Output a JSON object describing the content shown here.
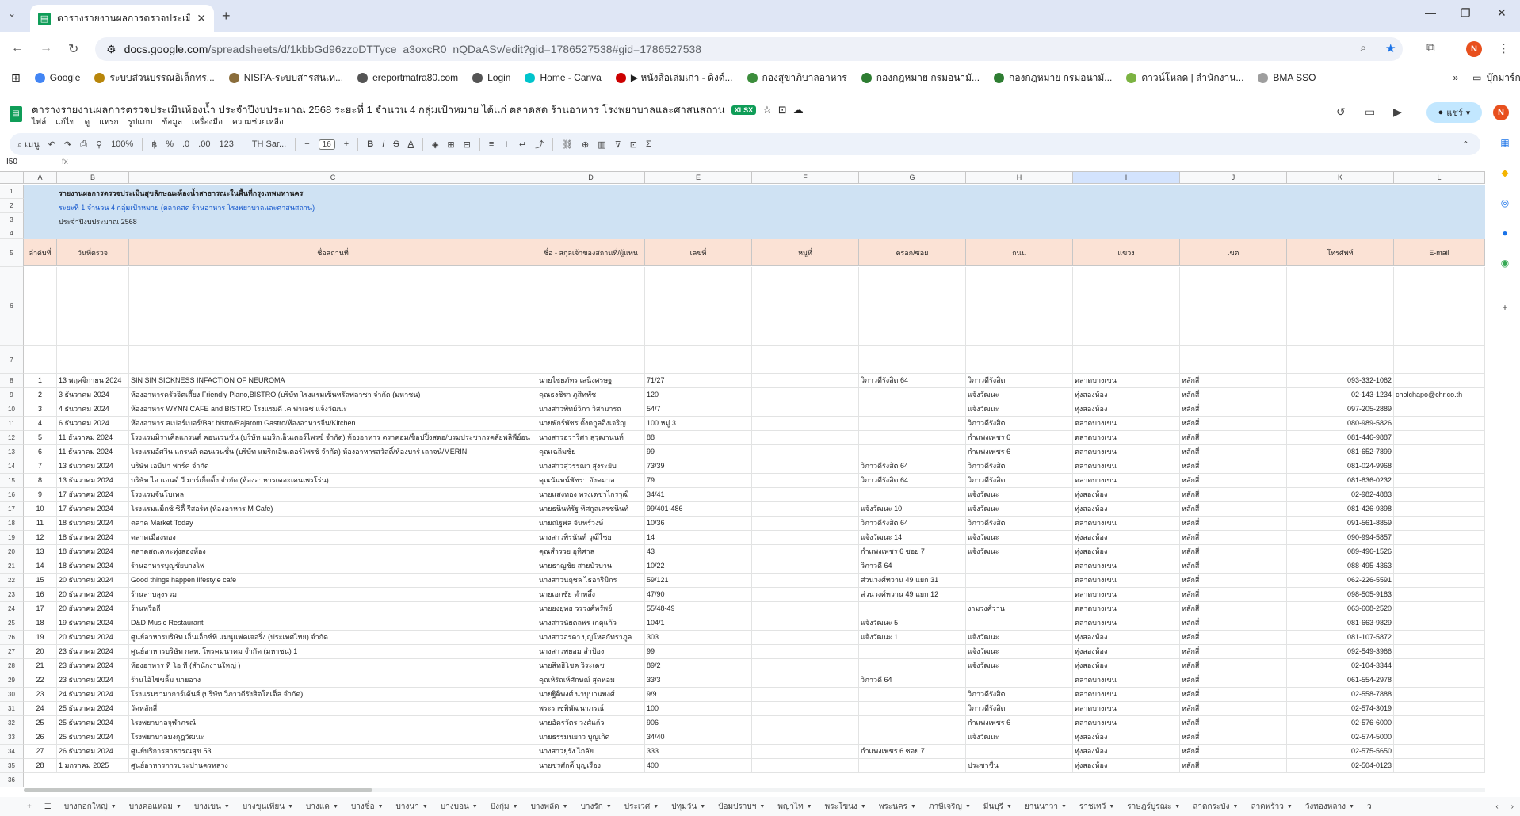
{
  "browser": {
    "tab_title": "ตารางรายงานผลการตรวจประเมินห้อง",
    "url_host": "docs.google.com",
    "url_path": "/spreadsheets/d/1kbbGd96zzoDTTyce_a3oxcR0_nQDaASv/edit?gid=1786527538#gid=1786527538",
    "profile_initial": "N",
    "bookmarks": [
      "Google",
      "ระบบส่วนบรรณอิเล็กทร...",
      "NISPA-ระบบสารสนเท...",
      "ereportmatra80.com",
      "Login",
      "Home - Canva",
      "▶ หนังสือเล่มเก่า - ดิงด์...",
      "กองสุขาภิบาลอาหาร",
      "กองกฎหมาย กรมอนามั...",
      "กองกฎหมาย กรมอนามั...",
      "ดาวน์โหลด | สำนักงาน...",
      "BMA SSO"
    ],
    "bookmarks_folder": "บุ๊กมาร์กทั้งหมด"
  },
  "sheets": {
    "doc_title": "ตารางรายงานผลการตรวจประเมินห้องน้ำ ประจำปีงบประมาณ 2568 ระยะที่ 1 จำนวน 4 กลุ่มเป้าหมาย ได้แก่ ตลาดสด ร้านอาหาร โรงพยาบาลและศาสนสถาน",
    "file_badge": "XLSX",
    "menus": [
      "ไฟล์",
      "แก้ไข",
      "ดู",
      "แทรก",
      "รูปแบบ",
      "ข้อมูล",
      "เครื่องมือ",
      "ความช่วยเหลือ"
    ],
    "share_label": "แชร์",
    "toolbar": {
      "menu": "เมนู",
      "zoom": "100%",
      "currency": "฿",
      "percent": "%",
      "format_123": "123",
      "font": "TH Sar...",
      "font_size": "16"
    },
    "name_box": "I50",
    "fx": "fx"
  },
  "grid": {
    "columns": [
      "A",
      "B",
      "C",
      "D",
      "E",
      "F",
      "G",
      "H",
      "I",
      "J",
      "K",
      "L"
    ],
    "selected_column": "I",
    "row_numbers": [
      "1",
      "2",
      "3",
      "4",
      "5",
      "6",
      "7",
      "8",
      "9",
      "10",
      "11",
      "12",
      "13",
      "14",
      "15",
      "16",
      "17",
      "18",
      "19",
      "20",
      "21",
      "22",
      "23",
      "24",
      "25",
      "26",
      "27",
      "28",
      "29",
      "30",
      "31",
      "32",
      "33",
      "34",
      "35",
      "36"
    ],
    "title_line1": "รายงานผลการตรวจประเมินสุขลักษณะห้องน้ำสาธารณะในพื้นที่กรุงเทพมหานคร",
    "title_line2": "ระยะที่ 1 จำนวน 4 กลุ่มเป้าหมาย (ตลาดสด ร้านอาหาร โรงพยาบาลและศาสนสถาน)",
    "title_line3": "ประจำปีงบประมาณ 2568",
    "headers": [
      "ลำดับที่",
      "วันที่ตรวจ",
      "ชื่อสถานที่",
      "ชื่อ - สกุลเจ้าของสถานที่/ผู้แทน",
      "เลขที่",
      "หมู่ที่",
      "ตรอก/ซอย",
      "ถนน",
      "แขวง",
      "เขต",
      "โทรศัพท์",
      "E-mail"
    ],
    "rows": [
      [
        "1",
        "13 พฤศจิกายน 2024",
        "SIN SIN SICKNESS INFACTION OF NEUROMA",
        "นายไชยภัทร เลนิ่งศรษฐ",
        "71/27",
        "",
        "วิภาวดีรังสิต 64",
        "วิภาวดีรังสิต",
        "ตลาดบางเขน",
        "หลักสี่",
        "093-332-1062",
        ""
      ],
      [
        "2",
        "3 ธันวาคม 2024",
        "ห้องอาหารครัวจิตเสี้ยง,Friendly Piano,BISTRO (บริษัท โรงแรมเซ็นทรัลพลาซา จำกัด (มหาชน)",
        "คุณธงชิรา ภูสิทพัช",
        "120",
        "",
        "",
        "แจ้งวัฒนะ",
        "ทุ่งสองห้อง",
        "หลักสี่",
        "02-143-1234",
        "cholchapo@chr.co.th"
      ],
      [
        "3",
        "4 ธันวาคม 2024",
        "ห้องอาหาร WYNN CAFE and BISTRO  โรงแรมดี เค พาเลซ แจ้งวัฒนะ",
        "นางสาวพิทย์วิภา วิสามารถ",
        "54/7",
        "",
        "",
        "แจ้งวัฒนะ",
        "ทุ่งสองห้อง",
        "หลักสี่",
        "097-205-2889",
        ""
      ],
      [
        "4",
        "6 ธันวาคม 2024",
        "ห้องอาหาร สเปอร์เบอร์/Bar bistro/Rajarom Gastro/ห้องอาหารจีน/Kitchen",
        "นายพักร์พัชร ตั้งตกูลอิงเจริญ",
        "100 หมู่ 3",
        "",
        "",
        "วิภาวดีรังสิต",
        "ตลาดบางเขน",
        "หลักสี่",
        "080-989-5826",
        ""
      ],
      [
        "5",
        "11 ธันวาคม 2024",
        "โรงแรมมิราเคิลแกรนด์ คอนเวนชั่น (บริษัท แมริกเอ็นเตอร์ไพรซ์ จำกัด) ห้องอาหาร ตราคอม/ช็อปปิ้งสตอ/บรมประชากรคลัยพลิพีย์อน",
        "นางสาวอวาริศา สุวุฒานนท์",
        "88",
        "",
        "",
        "กำแพงเพชร 6",
        "ตลาดบางเขน",
        "หลักสี่",
        "081-446-9887",
        ""
      ],
      [
        "6",
        "11 ธันวาคม 2024",
        "โรงแรมอัศวิน แกรนด์ คอนเวนชั่น (บริษัท แมริกเอ็นเตอร์ไพรซ์ จำกัด) ห้องอาหารสวัสดิ์/ห้องบาร์ เลาจน์/MERIN",
        "คุณเฉลิมชัย",
        "99",
        "",
        "",
        "กำแพงเพชร 6",
        "ตลาดบางเขน",
        "หลักสี่",
        "081-652-7899",
        ""
      ],
      [
        "7",
        "13 ธันวาคม 2024",
        "บริษัท เอบีน่า พาร์ค จำกัด",
        "นางสาวสุวรรณา สุ่งระยับ",
        "73/39",
        "",
        "วิภาวดีรังสิต 64",
        "วิภาวดีรังสิต",
        "ตลาดบางเขน",
        "หลักสี่",
        "081-024-9968",
        ""
      ],
      [
        "8",
        "13 ธันวาคม 2024",
        "บริษัท ไอ แอนด์ วี มาร์เก็ตติ้ง จำกัด (ห้องอาหารเดอะเคนเพรโร่น)",
        "คุณนันทน์พัชรา อังคมาล",
        "79",
        "",
        "วิภาวดีรังสิต 64",
        "วิภาวดีรังสิต",
        "ตลาดบางเขน",
        "หลักสี่",
        "081-836-0232",
        ""
      ],
      [
        "9",
        "17 ธันวาคม 2024",
        "โรงแรมจันโบเทล",
        "นายแสงทอง ทรงเดชาไกรวุฒิ",
        "34/41",
        "",
        "",
        "แจ้งวัฒนะ",
        "ทุ่งสองห้อง",
        "หลักสี่",
        "02-982-4883",
        ""
      ],
      [
        "10",
        "17 ธันวาคม 2024",
        "โรงแรมแม็กซ์ ซิตี้ รีสอร์ท (ห้องอาหาร M Cafe)",
        "นายธนินท์รัฐ ทิศกูลเตรชนินท์",
        "99/401-486",
        "",
        "แจ้งวัฒนะ 10",
        "แจ้งวัฒนะ",
        "ทุ่งสองห้อง",
        "หลักสี่",
        "081-426-9398",
        ""
      ],
      [
        "11",
        "18 ธันวาคม 2024",
        "ตลาด Market Today",
        "นายณัฐพล จันทร์วงษ์",
        "10/36",
        "",
        "วิภาวดีรังสิต 64",
        "วิภาวดีรังสิต",
        "ตลาดบางเขน",
        "หลักสี่",
        "091-561-8859",
        ""
      ],
      [
        "12",
        "18 ธันวาคม 2024",
        "ตลาดเมืองทอง",
        "นางสาวพิรนันท์ วุฒิไชย",
        "14",
        "",
        "แจ้งวัฒนะ 14",
        "แจ้งวัฒนะ",
        "ทุ่งสองห้อง",
        "หลักสี่",
        "090-994-5857",
        ""
      ],
      [
        "13",
        "18 ธันวาคม 2024",
        "ตลาดสดเคหะทุ่งสองห้อง",
        "คุณสำรวย อุทิศาล",
        "43",
        "",
        "กำแพงเพชร 6 ซอย 7",
        "แจ้งวัฒนะ",
        "ทุ่งสองห้อง",
        "หลักสี่",
        "089-496-1526",
        ""
      ],
      [
        "14",
        "18 ธันวาคม 2024",
        "ร้านอาหารบุญชัยบางโพ",
        "นายธาญชัย สายบัวบาน",
        "10/22",
        "",
        "วิภาวดี 64",
        "",
        "ตลาดบางเขน",
        "หลักสี่",
        "088-495-4363",
        ""
      ],
      [
        "15",
        "20 ธันวาคม 2024",
        "Good things happen lifestyle cafe",
        "นางสาวนฤชล ไธอาริมิกร",
        "59/121",
        "",
        "ส่วนวงศ์ทวาน 49 แยก 31",
        "",
        "ตลาดบางเขน",
        "หลักสี่",
        "062-226-5591",
        ""
      ],
      [
        "16",
        "20 ธันวาคม 2024",
        "ร้านลาบลุงรวม",
        "นายเอกชัย ตำทลึ้ง",
        "47/90",
        "",
        "ส่วนวงศ์ทวาน 49 แยก 12",
        "",
        "ตลาดบางเขน",
        "หลักสี่",
        "098-505-9183",
        ""
      ],
      [
        "17",
        "20 ธันวาคม 2024",
        "ร้านหรือกี",
        "นายยงยุทธ วรวงศ์ทรัพย์",
        "55/48-49",
        "",
        "",
        "งามวงศ์วาน",
        "ตลาดบางเขน",
        "หลักสี่",
        "063-608-2520",
        ""
      ],
      [
        "18",
        "19 ธันวาคม 2024",
        "D&D Music Restaurant",
        "นางสาวนัยดลพร เกตุแก้ว",
        "104/1",
        "",
        "แจ้งวัฒนะ 5",
        "",
        "ตลาดบางเขน",
        "หลักสี่",
        "081-663-9829",
        ""
      ],
      [
        "19",
        "20 ธันวาคม 2024",
        "ศูนย์อาหารบริษัท เอ็นเอ็กซ์ที แมนูแฟคเจอริ่ง (ประเทศไทย) จำกัด",
        "นางสาวอรดา บุญโหลกัทราภูล",
        "303",
        "",
        "แจ้งวัฒนะ 1",
        "แจ้งวัฒนะ",
        "ทุ่งสองห้อง",
        "หลักสี่",
        "081-107-5872",
        ""
      ],
      [
        "20",
        "23 ธันวาคม 2024",
        "ศูนย์อาหารบริษัท กสท. โทรคมนาคม จำกัด (มหาชน) 1",
        "นางสาวพยอม ลำป้อง",
        "99",
        "",
        "",
        "แจ้งวัฒนะ",
        "ทุ่งสองห้อง",
        "หลักสี่",
        "092-549-3966",
        ""
      ],
      [
        "21",
        "23 ธันวาคม 2024",
        "ห้องอาหาร ที โอ ที (สำนักงานใหญ่ )",
        "นายสิทธิโชค วิระเดช",
        "89/2",
        "",
        "",
        "แจ้งวัฒนะ",
        "ทุ่งสองห้อง",
        "หลักสี่",
        "02-104-3344",
        ""
      ],
      [
        "22",
        "23 ธันวาคม 2024",
        "ร้านไอ้ไข่ขลิ้ม นายอาง",
        "คุณหิรัณห์ศักษณ์ สุดทอม",
        "33/3",
        "",
        "วิภาวดี 64",
        "",
        "ตลาดบางเขน",
        "หลักสี่",
        "061-554-2978",
        ""
      ],
      [
        "23",
        "24 ธันวาคม 2024",
        "โรงแรมรามาการ์เด้นส์ (บริษัท วิภาวดีรังสิตโฮเต็ล จำกัด)",
        "นายฐิติพงศ์ นาบุบานพงศ์",
        "9/9",
        "",
        "",
        "วิภาวดีรังสิต",
        "ตลาดบางเขน",
        "หลักสี่",
        "02-558-7888",
        ""
      ],
      [
        "24",
        "25 ธันวาคม 2024",
        "วัดหลักสี่",
        "พระราชพิพัฒนาภรณ์",
        "100",
        "",
        "",
        "วิภาวดีรังสิต",
        "ตลาดบางเขน",
        "หลักสี่",
        "02-574-3019",
        ""
      ],
      [
        "25",
        "25 ธันวาคม 2024",
        "โรงพยาบาลจุฬาภรณ์",
        "นายอัครวัตร วงศ์แก้ว",
        "906",
        "",
        "",
        "กำแพงเพชร 6",
        "ตลาดบางเขน",
        "หลักสี่",
        "02-576-6000",
        ""
      ],
      [
        "26",
        "25 ธันวาคม 2024",
        "โรงพยาบาลมงกุฎวัฒนะ",
        "นายธรรมนยาว บุญเกิด",
        "34/40",
        "",
        "",
        "แจ้งวัฒนะ",
        "ทุ่งสองห้อง",
        "หลักสี่",
        "02-574-5000",
        ""
      ],
      [
        "27",
        "26 ธันวาคม 2024",
        "ศูนย์บริการสาธารณสุข 53",
        "นางสาวยุรัง ไกลัย",
        "333",
        "",
        "กำแพงเพชร 6 ซอย 7",
        "",
        "ทุ่งสองห้อง",
        "หลักสี่",
        "02-575-5650",
        ""
      ],
      [
        "28",
        "1 มกราคม 2025",
        "ศูนย์อาหารการประปานครหลวง",
        "นายชรศักดิ์ บุญเรือง",
        "400",
        "",
        "",
        "ประชาชื่น",
        "ทุ่งสองห้อง",
        "หลักสี่",
        "02-504-0123",
        ""
      ]
    ]
  },
  "sheet_tabs": [
    "บางกอกใหญ่",
    "บางคอแหลม",
    "บางเขน",
    "บางขุนเทียน",
    "บางแค",
    "บางซื่อ",
    "บางนา",
    "บางบอน",
    "บึงกุ่ม",
    "บางพลัด",
    "บางรัก",
    "ประเวศ",
    "ปทุมวัน",
    "ป้อมปราบฯ",
    "พญาไท",
    "พระโขนง",
    "พระนคร",
    "ภาษีเจริญ",
    "มีนบุรี",
    "ยานนาวา",
    "ราชเทวี",
    "ราษฎร์บูรณะ",
    "ลาดกระบัง",
    "ลาดพร้าว",
    "วังทองหลาง",
    "ว"
  ]
}
